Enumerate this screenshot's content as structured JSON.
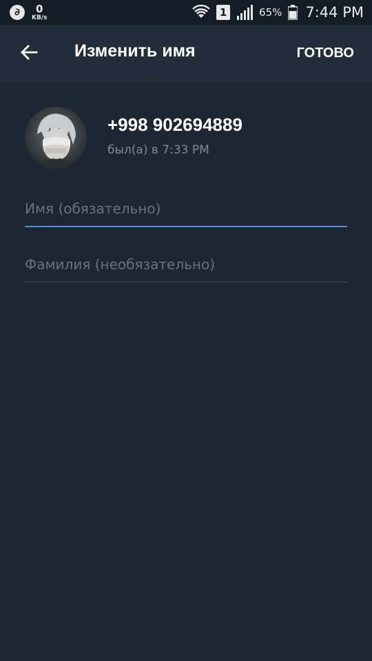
{
  "status_bar": {
    "net_speed_value": "0",
    "net_speed_unit": "KB/s",
    "sim_slot": "1",
    "battery_percent": "65%",
    "time": "7:44 PM"
  },
  "action_bar": {
    "title": "Изменить имя",
    "done_label": "ГОТОВО"
  },
  "profile": {
    "phone": "+998 902694889",
    "last_seen": "был(а) в 7:33 PM"
  },
  "form": {
    "first_name_placeholder": "Имя (обязательно)",
    "first_name_value": "",
    "last_name_placeholder": "Фамилия (необязательно)",
    "last_name_value": ""
  },
  "colors": {
    "background": "#1d2733",
    "action_bar": "#212d3b",
    "status_bar": "#141c25",
    "accent_underline": "#4b8fd6",
    "secondary_text": "#7d8b99"
  }
}
